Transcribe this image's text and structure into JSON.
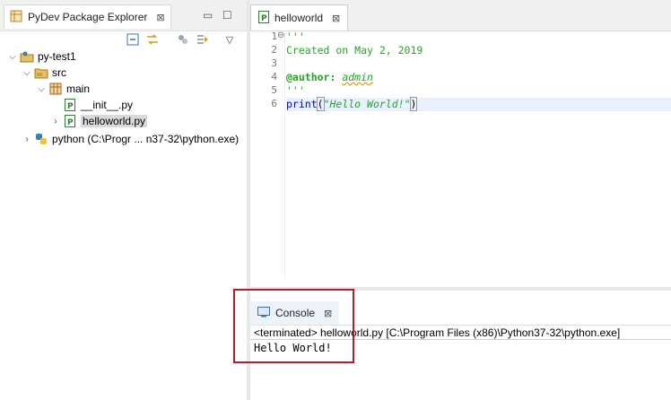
{
  "explorer": {
    "title": "PyDev Package Explorer",
    "close": "⊠",
    "minimize": "▭",
    "maximize": "☐",
    "menu": "▽",
    "tree": [
      {
        "label": "py-test1"
      },
      {
        "label": "src"
      },
      {
        "label": "main"
      },
      {
        "label": "__init__.py"
      },
      {
        "label": "helloworld.py"
      },
      {
        "label": "python  (C:\\Progr ... n37-32\\python.exe)"
      }
    ]
  },
  "editor": {
    "tab_label": "helloworld",
    "close": "⊠",
    "line_numbers": [
      "1",
      "2",
      "3",
      "4",
      "5",
      "6"
    ],
    "lines": {
      "l1": "'''",
      "l2": "Created on May 2, 2019",
      "l3": "",
      "l4_deco": "@author:",
      "l4_val": "admin",
      "l5": "'''",
      "l6_fn": "print",
      "l6_open": "(",
      "l6_str": "\"Hello World!\"",
      "l6_close": ")"
    }
  },
  "console": {
    "tab_label": "Console",
    "close": "⊠",
    "status": "<terminated> helloworld.py [C:\\Program Files (x86)\\Python37-32\\python.exe]",
    "output": "Hello World!"
  },
  "colors": {
    "highlight_border": "#b01e2a",
    "string_green": "#2aa02a",
    "keyword_blue": "#0000cc"
  }
}
